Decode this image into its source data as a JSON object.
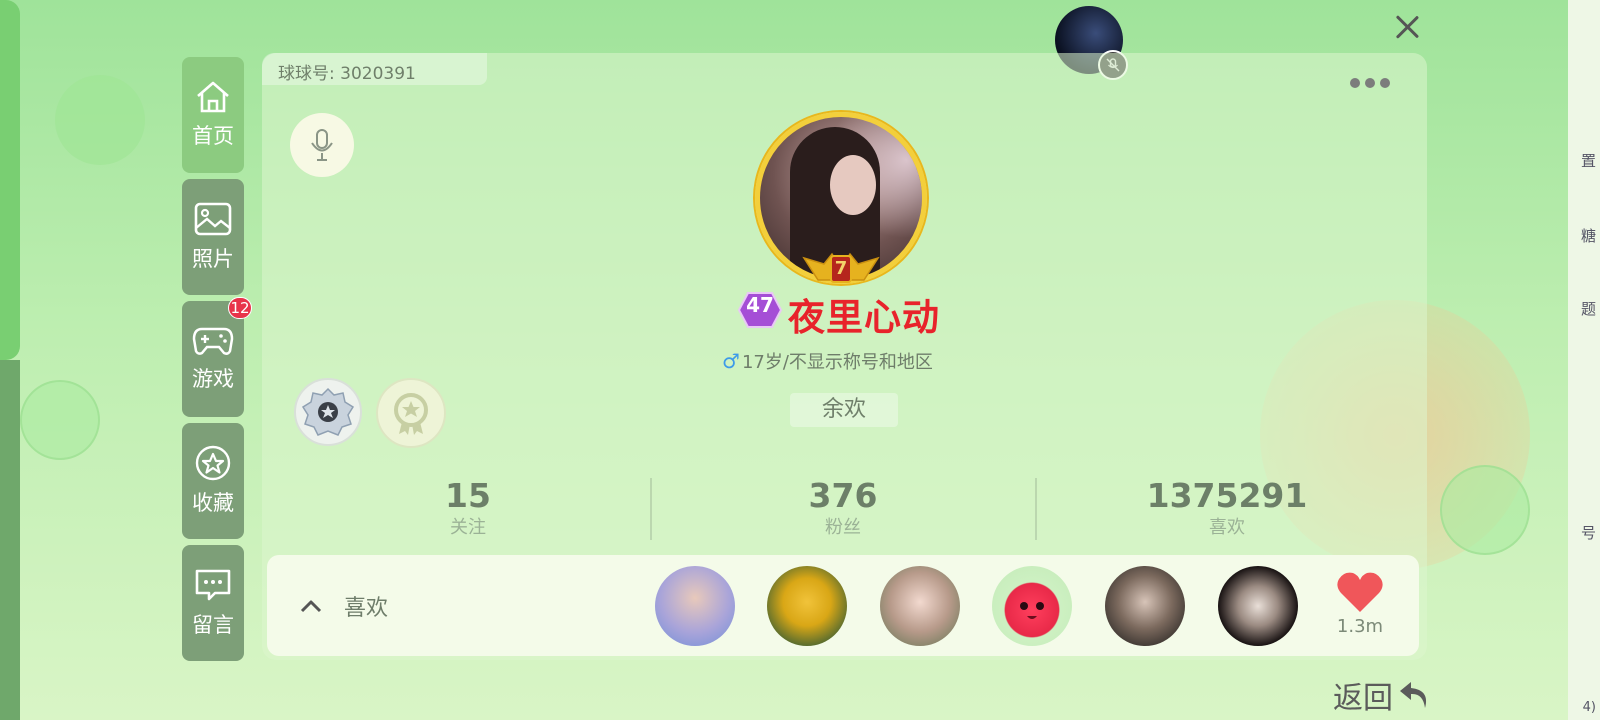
{
  "header": {
    "ball_id": "球球号: 3020391"
  },
  "nav": {
    "items": [
      {
        "label": "首页",
        "icon": "home-icon",
        "active": true
      },
      {
        "label": "照片",
        "icon": "image-icon",
        "active": false
      },
      {
        "label": "游戏",
        "icon": "gamepad-icon",
        "active": false,
        "badge": "12"
      },
      {
        "label": "收藏",
        "icon": "star-icon",
        "active": false
      },
      {
        "label": "留言",
        "icon": "message-icon",
        "active": false
      }
    ]
  },
  "profile": {
    "level": "47",
    "rank": "7",
    "nickname": "夜里心动",
    "info": "17岁/不显示称号和地区",
    "signature": "余欢"
  },
  "stats": [
    {
      "value": "15",
      "label": "关注"
    },
    {
      "value": "376",
      "label": "粉丝"
    },
    {
      "value": "1375291",
      "label": "喜欢"
    }
  ],
  "likes": {
    "label": "喜欢",
    "count": "1.3m"
  },
  "footer": {
    "back_label": "返回"
  },
  "edge_texts": [
    "置",
    "糖",
    "题",
    "号",
    "4)"
  ],
  "colors": {
    "nickname": "#e8232b",
    "nav_active": "#8ccb80",
    "nav_inactive": "#7d9f78",
    "badge": "#e8334a",
    "heart": "#f0565a"
  }
}
